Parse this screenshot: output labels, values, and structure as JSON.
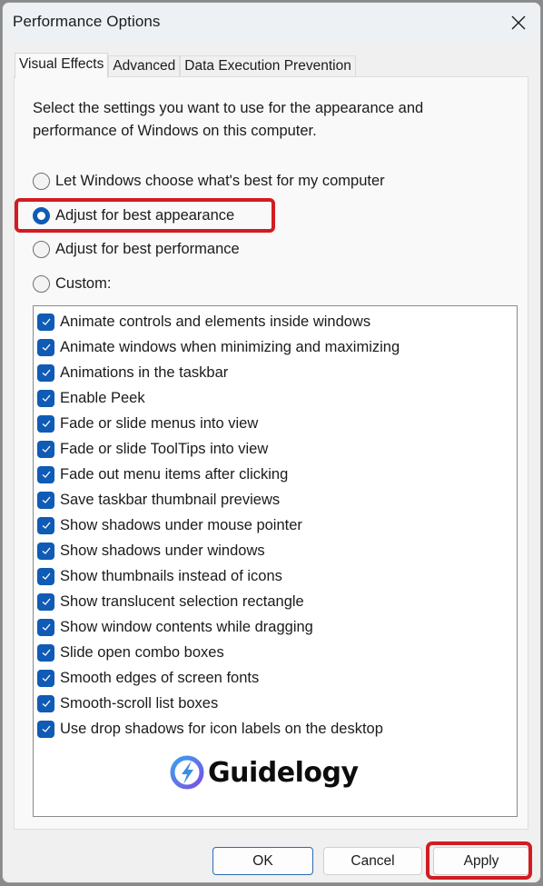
{
  "window": {
    "title": "Performance Options",
    "close_icon": "close-icon"
  },
  "tabs": [
    {
      "label": "Visual Effects",
      "active": true
    },
    {
      "label": "Advanced",
      "active": false
    },
    {
      "label": "Data Execution Prevention",
      "active": false
    }
  ],
  "visual_effects": {
    "description": "Select the settings you want to use for the appearance and performance of Windows on this computer.",
    "options": [
      {
        "label": "Let Windows choose what's best for my computer",
        "checked": false
      },
      {
        "label": "Adjust for best appearance",
        "checked": true
      },
      {
        "label": "Adjust for best performance",
        "checked": false
      },
      {
        "label": "Custom:",
        "checked": false
      }
    ],
    "settings": [
      {
        "label": "Animate controls and elements inside windows",
        "checked": true
      },
      {
        "label": "Animate windows when minimizing and maximizing",
        "checked": true
      },
      {
        "label": "Animations in the taskbar",
        "checked": true
      },
      {
        "label": "Enable Peek",
        "checked": true
      },
      {
        "label": "Fade or slide menus into view",
        "checked": true
      },
      {
        "label": "Fade or slide ToolTips into view",
        "checked": true
      },
      {
        "label": "Fade out menu items after clicking",
        "checked": true
      },
      {
        "label": "Save taskbar thumbnail previews",
        "checked": true
      },
      {
        "label": "Show shadows under mouse pointer",
        "checked": true
      },
      {
        "label": "Show shadows under windows",
        "checked": true
      },
      {
        "label": "Show thumbnails instead of icons",
        "checked": true
      },
      {
        "label": "Show translucent selection rectangle",
        "checked": true
      },
      {
        "label": "Show window contents while dragging",
        "checked": true
      },
      {
        "label": "Slide open combo boxes",
        "checked": true
      },
      {
        "label": "Smooth edges of screen fonts",
        "checked": true
      },
      {
        "label": "Smooth-scroll list boxes",
        "checked": true
      },
      {
        "label": "Use drop shadows for icon labels on the desktop",
        "checked": true
      }
    ]
  },
  "watermark": {
    "icon": "lightning-bolt-logo-icon",
    "text": "Guidelogy"
  },
  "footer": {
    "ok_label": "OK",
    "cancel_label": "Cancel",
    "apply_label": "Apply"
  },
  "colors": {
    "accent": "#0f5bb5",
    "highlight": "#d21c22"
  }
}
